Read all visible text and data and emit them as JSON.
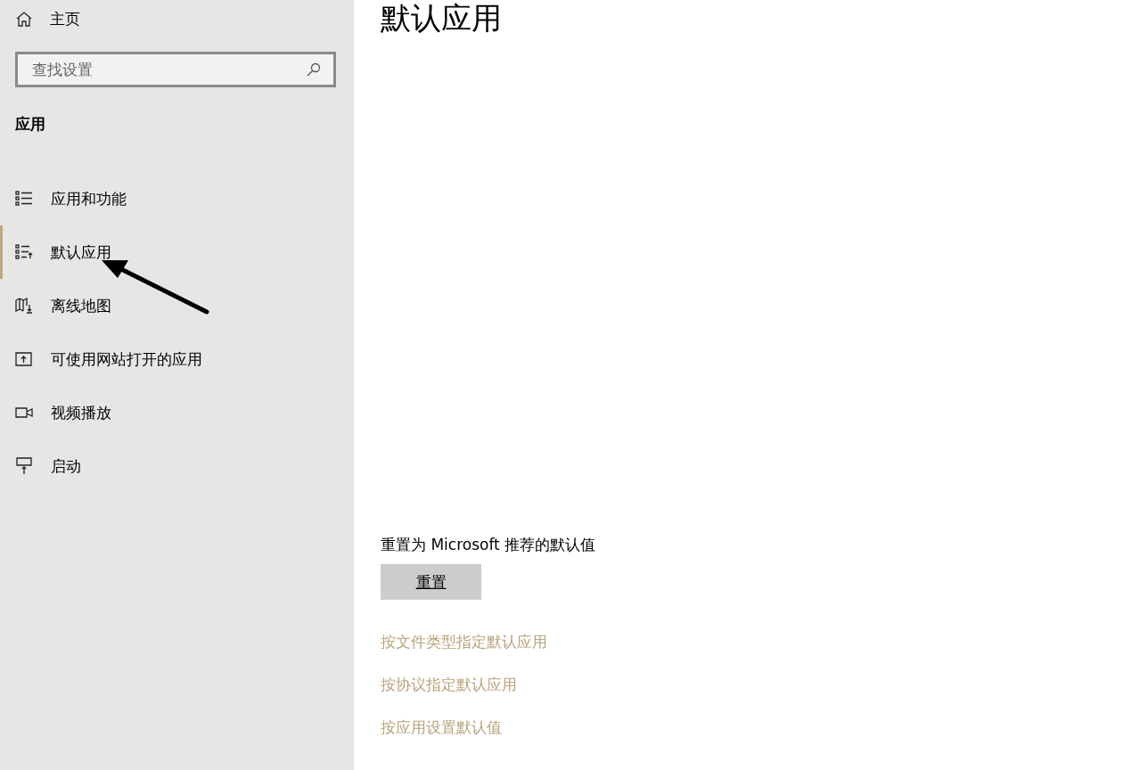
{
  "sidebar": {
    "home": {
      "label": "主页"
    },
    "search": {
      "placeholder": "查找设置"
    },
    "section_title": "应用",
    "items": [
      {
        "label": "应用和功能",
        "kind": "list",
        "selected": false
      },
      {
        "label": "默认应用",
        "kind": "defaults",
        "selected": true
      },
      {
        "label": "离线地图",
        "kind": "map",
        "selected": false
      },
      {
        "label": "可使用网站打开的应用",
        "kind": "web",
        "selected": false
      },
      {
        "label": "视频播放",
        "kind": "video",
        "selected": false
      },
      {
        "label": "启动",
        "kind": "startup",
        "selected": false
      }
    ]
  },
  "main": {
    "title": "默认应用",
    "reset_label": "重置为 Microsoft 推荐的默认值",
    "reset_button": "重置",
    "links": [
      "按文件类型指定默认应用",
      "按协议指定默认应用",
      "按应用设置默认值"
    ]
  }
}
